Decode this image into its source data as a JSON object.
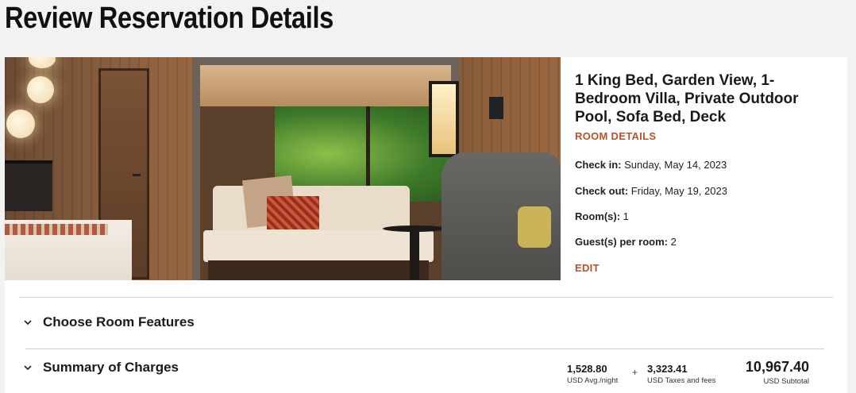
{
  "page": {
    "title": "Review Reservation Details"
  },
  "room": {
    "name": "1 King Bed, Garden View, 1-Bedroom Villa, Private Outdoor Pool, Sofa Bed, Deck",
    "details_link": "ROOM DETAILS",
    "photo_alt": "Villa interior"
  },
  "stay": {
    "check_in_label": "Check in:",
    "check_in_value": "Sunday, May 14, 2023",
    "check_out_label": "Check out:",
    "check_out_value": "Friday, May 19, 2023",
    "rooms_label": "Room(s):",
    "rooms_value": "1",
    "guests_label": "Guest(s) per room:",
    "guests_value": "2",
    "edit_link": "EDIT"
  },
  "sections": {
    "features_label": "Choose Room Features",
    "summary_label": "Summary of Charges"
  },
  "charges": {
    "avg_night_amount": "1,528.80",
    "avg_night_label": "USD Avg./night",
    "plus": "+",
    "taxes_amount": "3,323.41",
    "taxes_label": "USD Taxes and fees",
    "subtotal_amount": "10,967.40",
    "subtotal_label": "USD Subtotal"
  },
  "colors": {
    "accent": "#b5532a",
    "background": "#f2f2f2",
    "card": "#ffffff"
  },
  "icons": {
    "features_chevron": "chevron-down-icon",
    "summary_chevron": "chevron-down-icon"
  }
}
